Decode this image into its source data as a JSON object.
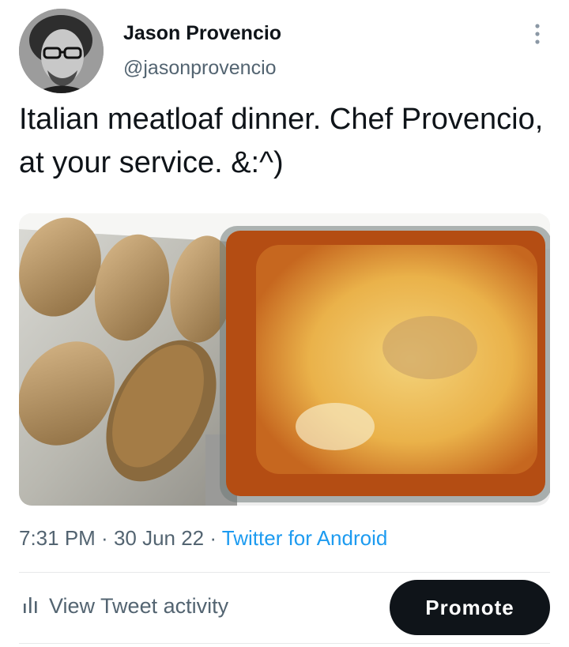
{
  "author": {
    "name": "Jason Provencio",
    "handle": "@jasonprovencio"
  },
  "tweet": {
    "text": "Italian meatloaf dinner. Chef Provencio, at your service. &:^)"
  },
  "meta": {
    "time": "7:31 PM",
    "sep1": " · ",
    "date": "30 Jun 22",
    "sep2": " · ",
    "source": "Twitter for Android"
  },
  "actions": {
    "view_activity": "View Tweet activity",
    "promote": "Promote"
  },
  "icons": {
    "more": "more-vertical-icon",
    "analytics": "analytics-bars-icon"
  },
  "colors": {
    "link": "#1d9bf0",
    "secondary_text": "#536471",
    "button_bg": "#0f1419",
    "divider": "#e7e9ea"
  }
}
